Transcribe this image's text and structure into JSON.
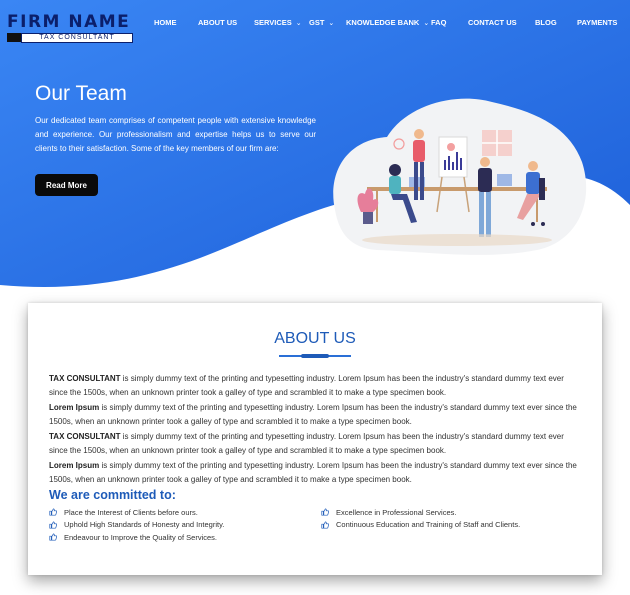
{
  "brand": {
    "name": "FIRM NAME",
    "tagline": "TAX CONSULTANT"
  },
  "nav": {
    "items": [
      {
        "label": "HOME"
      },
      {
        "label": "ABOUT US"
      },
      {
        "label": "SERVICES"
      },
      {
        "label": "GST"
      },
      {
        "label": "KNOWLEDGE BANK"
      },
      {
        "label": "FAQ"
      },
      {
        "label": "CONTACT US"
      },
      {
        "label": "BLOG"
      },
      {
        "label": "PAYMENTS"
      }
    ]
  },
  "hero": {
    "title": "Our Team",
    "text": "Our dedicated team comprises of competent people with extensive knowledge and experience. Our professionalism and expertise helps us to serve our clients to their satisfaction. Some of the key members of our firm are:",
    "button": "Read More"
  },
  "about": {
    "title": "ABOUT US",
    "paragraphs": [
      {
        "bold": "TAX CONSULTANT",
        "text": " is simply dummy text of the printing and typesetting industry. Lorem Ipsum has been the industry's standard dummy text ever since the 1500s, when an unknown printer took a galley of type and scrambled it to make a type specimen book."
      },
      {
        "bold": "Lorem Ipsum",
        "text": " is simply dummy text of the printing and typesetting industry. Lorem Ipsum has been the industry's standard dummy text ever since the 1500s, when an unknown printer took a galley of type and scrambled it to make a type specimen book."
      },
      {
        "bold": "TAX CONSULTANT",
        "text": " is simply dummy text of the printing and typesetting industry. Lorem Ipsum has been the industry's standard dummy text ever since the 1500s, when an unknown printer took a galley of type and scrambled it to make a type specimen book."
      },
      {
        "bold": "Lorem Ipsum",
        "text": " is simply dummy text of the printing and typesetting industry. Lorem Ipsum has been the industry's standard dummy text ever since the 1500s, when an unknown printer took a galley of type and scrambled it to make a type specimen book."
      }
    ],
    "committed_heading": "We are committed to:",
    "commitments_left": [
      "Place the Interest of Clients before ours.",
      "Uphold High Standards of Honesty and Integrity.",
      "Endeavour to Improve the Quality of Services."
    ],
    "commitments_right": [
      "Excellence in Professional Services.",
      "Continuous Education and Training of Staff and Clients."
    ]
  },
  "colors": {
    "hero_blue": "#2f7df0",
    "hero_blue_dark": "#1f5fd6",
    "heading_blue": "#1e5bb8",
    "button_black": "#0a0a0a"
  },
  "icons": {
    "nav_dropdown": "chevron-down-icon",
    "list_bullet": "thumbs-up-icon"
  }
}
